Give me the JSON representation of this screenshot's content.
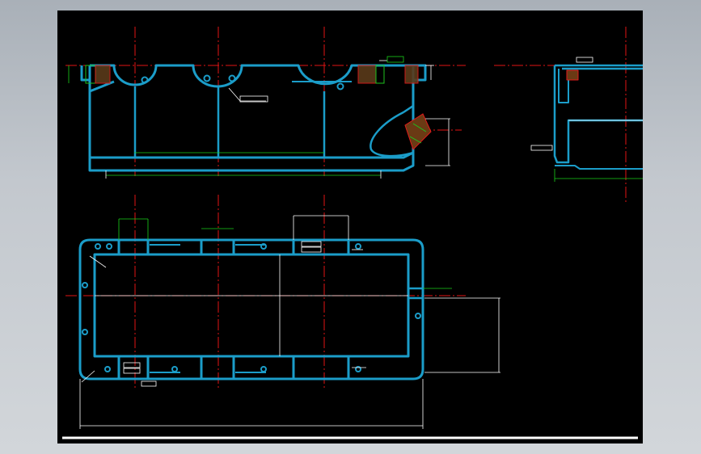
{
  "colors": {
    "background": "#000000",
    "outline": "#1b9dc9",
    "centerline": "#e21414",
    "dimension": "#ffffff",
    "dimension_green": "#19d219",
    "hatch_red": "#e11b1b",
    "hatch_green": "#1ec21e",
    "frame_outer": "#b7bdc3"
  },
  "icons": {
    "drawing_canvas": "cad-drawing-viewport",
    "bottom_rule": "white-horizontal-rule"
  }
}
